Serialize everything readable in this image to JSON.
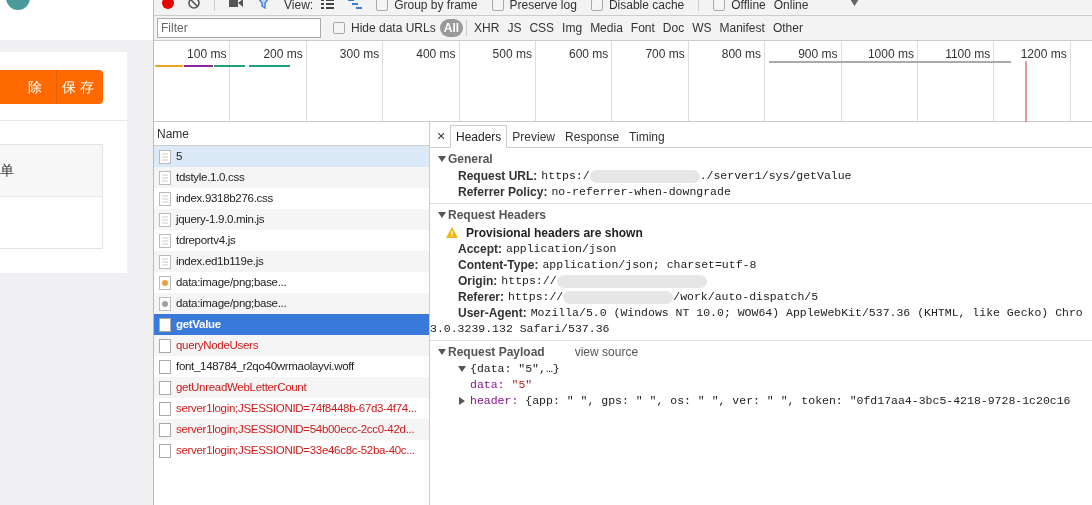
{
  "app": {
    "buttons": [
      {
        "label": "除"
      },
      {
        "label": "保存"
      }
    ],
    "table_cell": "单"
  },
  "toolbar": {
    "view_label": "View:",
    "checkboxes": [
      {
        "label": "Group by frame",
        "checked": false
      },
      {
        "label": "Preserve log",
        "checked": false
      },
      {
        "label": "Disable cache",
        "checked": false
      },
      {
        "label": "Offline",
        "checked": false
      }
    ],
    "throttle": "Online"
  },
  "filter": {
    "placeholder": "Filter",
    "hide_data_urls": {
      "label": "Hide data URLs",
      "checked": false
    },
    "types": [
      {
        "label": "All",
        "selected": true
      },
      {
        "label": "XHR",
        "selected": false
      },
      {
        "label": "JS",
        "selected": false
      },
      {
        "label": "CSS",
        "selected": false
      },
      {
        "label": "Img",
        "selected": false
      },
      {
        "label": "Media",
        "selected": false
      },
      {
        "label": "Font",
        "selected": false
      },
      {
        "label": "Doc",
        "selected": false
      },
      {
        "label": "WS",
        "selected": false
      },
      {
        "label": "Manifest",
        "selected": false
      },
      {
        "label": "Other",
        "selected": false
      }
    ]
  },
  "timeline": {
    "ticks": [
      "100 ms",
      "200 ms",
      "300 ms",
      "400 ms",
      "500 ms",
      "600 ms",
      "700 ms",
      "800 ms",
      "900 ms",
      "1000 ms",
      "1100 ms",
      "1200 ms"
    ]
  },
  "requests": {
    "column": "Name",
    "items": [
      {
        "name": "5",
        "kind": "document",
        "failed": false,
        "selected": false,
        "hovered": true
      },
      {
        "name": "tdstyle.1.0.css",
        "kind": "document",
        "failed": false,
        "selected": false,
        "hovered": false
      },
      {
        "name": "index.9318b276.css",
        "kind": "document",
        "failed": false,
        "selected": false,
        "hovered": false
      },
      {
        "name": "jquery-1.9.0.min.js",
        "kind": "document",
        "failed": false,
        "selected": false,
        "hovered": false
      },
      {
        "name": "tdreportv4.js",
        "kind": "document",
        "failed": false,
        "selected": false,
        "hovered": false
      },
      {
        "name": "index.ed1b119e.js",
        "kind": "document",
        "failed": false,
        "selected": false,
        "hovered": false
      },
      {
        "name": "data:image/png;base...",
        "kind": "image",
        "failed": false,
        "selected": false,
        "hovered": false,
        "color": "#f0a040"
      },
      {
        "name": "data:image/png;base...",
        "kind": "image",
        "failed": false,
        "selected": false,
        "hovered": false,
        "color": "#a0a0a0"
      },
      {
        "name": "getValue",
        "kind": "blank",
        "failed": false,
        "selected": true,
        "hovered": false
      },
      {
        "name": "queryNodeUsers",
        "kind": "blank",
        "failed": true,
        "selected": false,
        "hovered": false
      },
      {
        "name": "font_148784_r2qo40wrmaolayvi.woff",
        "kind": "blank",
        "failed": false,
        "selected": false,
        "hovered": false
      },
      {
        "name": "getUnreadWebLetterCount",
        "kind": "blank",
        "failed": true,
        "selected": false,
        "hovered": false
      },
      {
        "name": "server1login;JSESSIONID=74f8448b-67d3-4f74...",
        "kind": "blank",
        "failed": true,
        "selected": false,
        "hovered": false
      },
      {
        "name": "server1login;JSESSIONID=54b00ecc-2cc0-42d...",
        "kind": "blank",
        "failed": true,
        "selected": false,
        "hovered": false
      },
      {
        "name": "server1login;JSESSIONID=33e46c8c-52ba-40c...",
        "kind": "blank",
        "failed": true,
        "selected": false,
        "hovered": false
      }
    ]
  },
  "details": {
    "close": "×",
    "tabs": [
      {
        "label": "Headers",
        "selected": true
      },
      {
        "label": "Preview",
        "selected": false
      },
      {
        "label": "Response",
        "selected": false
      },
      {
        "label": "Timing",
        "selected": false
      }
    ],
    "general": {
      "title": "General",
      "expanded": true,
      "rows": [
        {
          "key": "Request URL:",
          "value": "https:/",
          "redacted": true,
          "value_end": "./server1/sys/getValue"
        },
        {
          "key": "Referrer Policy:",
          "value": "no-referrer-when-downgrade",
          "redacted": false
        }
      ]
    },
    "request_headers": {
      "title": "Request Headers",
      "expanded": true,
      "warning": "Provisional headers are shown",
      "rows": [
        {
          "key": "Accept:",
          "value": "application/json",
          "redacted": false
        },
        {
          "key": "Content-Type:",
          "value": "application/json; charset=utf-8",
          "redacted": false
        },
        {
          "key": "Origin:",
          "value": "https://",
          "redacted": true
        },
        {
          "key": "Referer:",
          "value": "https://",
          "redacted": true,
          "value_end": "/work/auto-dispatch/5"
        },
        {
          "key": "User-Agent:",
          "value": "Mozilla/5.0 (Windows NT 10.0; WOW64) AppleWebKit/537.36 (KHTML, like Gecko) Chro",
          "redacted": false,
          "value_line_2": "3.0.3239.132 Safari/537.36"
        }
      ]
    },
    "payload": {
      "title": "Request Payload",
      "expanded": true,
      "link": "view source",
      "summary": "{data: \"5\",…}",
      "summary_expanded": true,
      "children": [
        {
          "key": "data:",
          "value": "\"5\"",
          "kind": "string"
        },
        {
          "key": "header:",
          "value": "{app: \" \", gps: \" \", os: \" \", ver: \" \", token: \"0fd17aa4-3bc5-4218-9728-1c20c16",
          "kind": "object",
          "expanded": false
        }
      ]
    }
  }
}
